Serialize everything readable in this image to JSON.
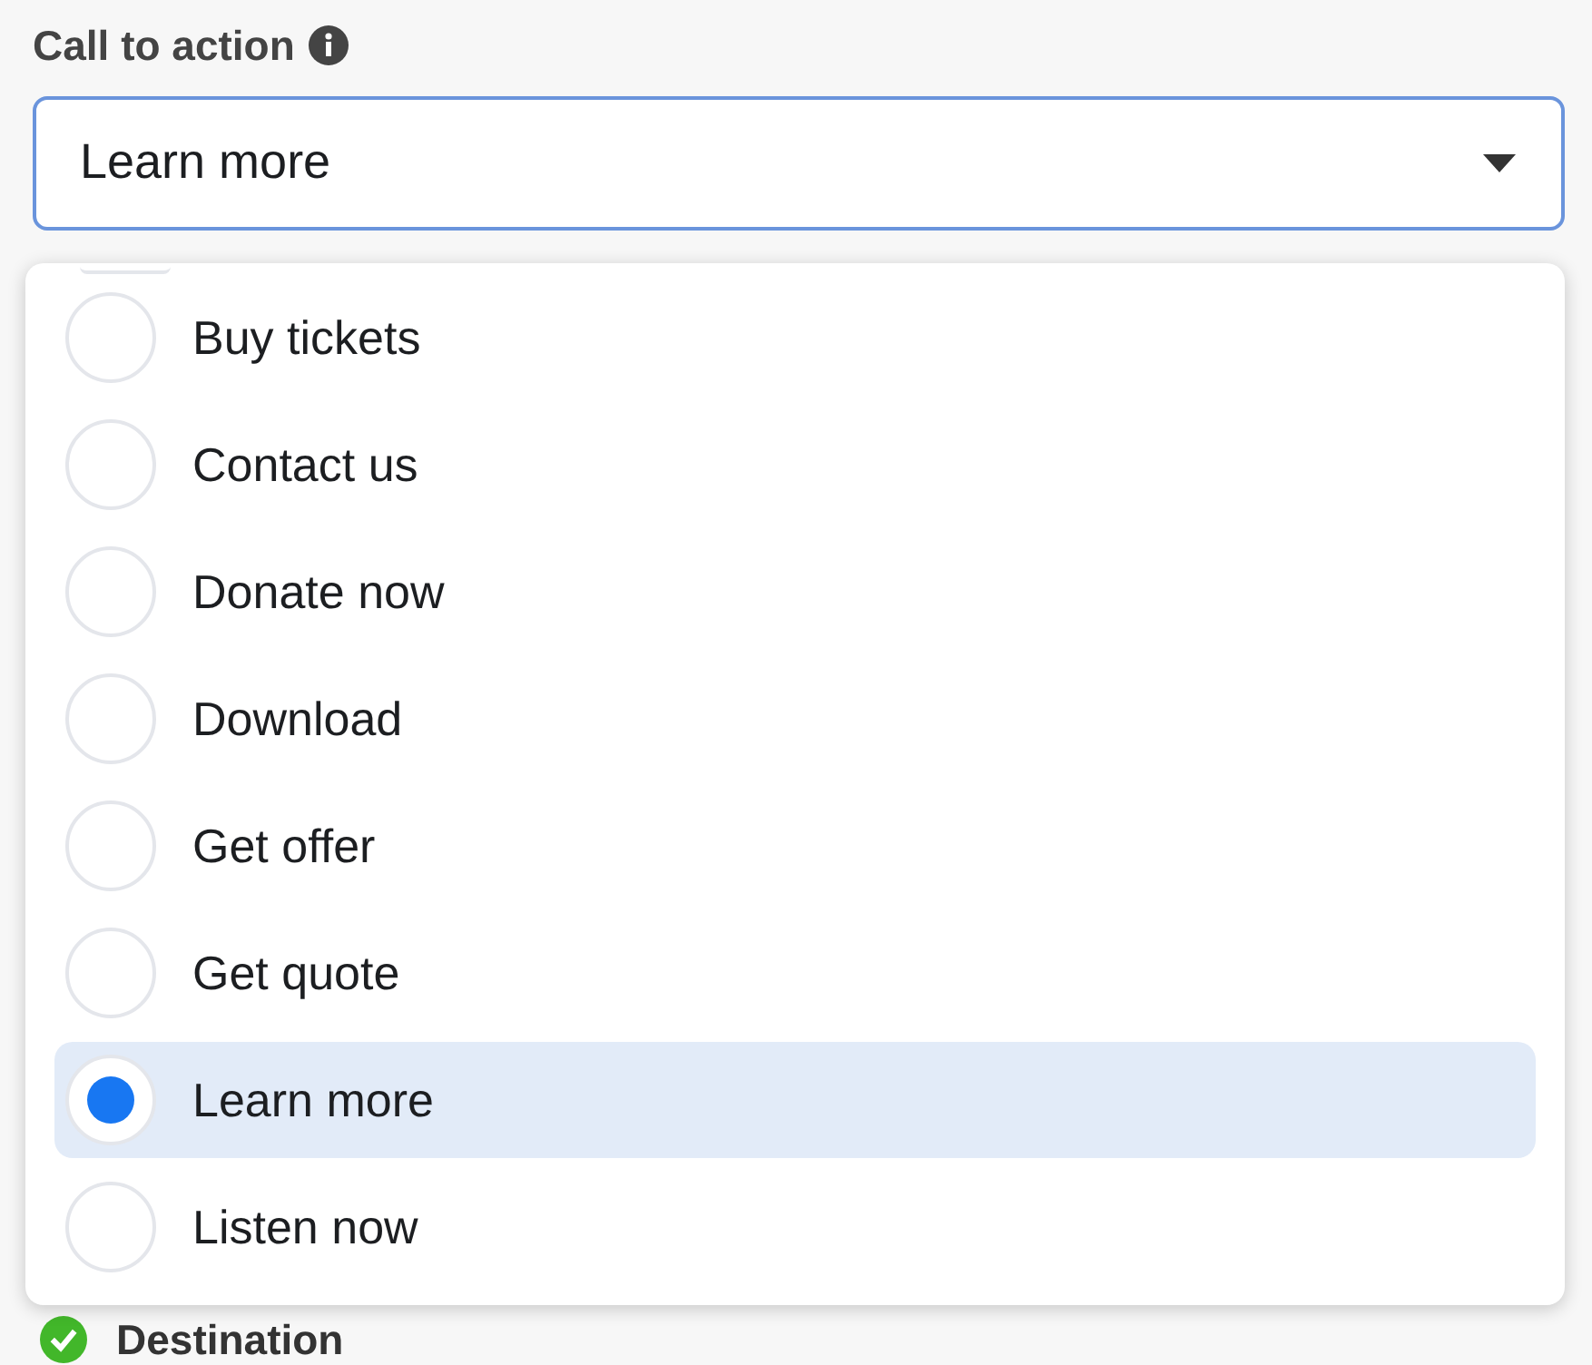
{
  "field": {
    "label": "Call to action",
    "value": "Learn more"
  },
  "options": [
    {
      "label": "Buy tickets",
      "selected": false
    },
    {
      "label": "Contact us",
      "selected": false
    },
    {
      "label": "Donate now",
      "selected": false
    },
    {
      "label": "Download",
      "selected": false
    },
    {
      "label": "Get offer",
      "selected": false
    },
    {
      "label": "Get quote",
      "selected": false
    },
    {
      "label": "Learn more",
      "selected": true
    },
    {
      "label": "Listen now",
      "selected": false
    }
  ],
  "next_section": {
    "title": "Destination",
    "complete": true
  }
}
